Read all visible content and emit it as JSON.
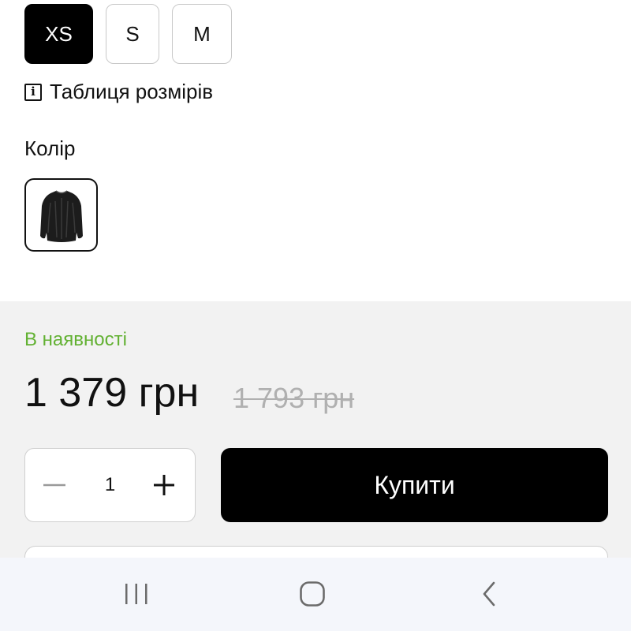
{
  "sizes": {
    "options": [
      {
        "label": "XS",
        "selected": true
      },
      {
        "label": "S",
        "selected": false
      },
      {
        "label": "M",
        "selected": false
      }
    ],
    "size_table_label": "Таблиця розмірів"
  },
  "color": {
    "label": "Колір",
    "swatch_icon": "black-sweater-thumbnail"
  },
  "purchase": {
    "availability": "В наявності",
    "price": "1 379 грн",
    "old_price": "1 793 грн",
    "quantity": "1",
    "buy_label": "Купити"
  },
  "theme": {
    "accent_dark": "#000000",
    "stock_green": "#62b132",
    "panel_bg": "#f2f2f2"
  },
  "system_nav": {
    "items": [
      "recents-icon",
      "home-icon",
      "back-icon"
    ]
  }
}
